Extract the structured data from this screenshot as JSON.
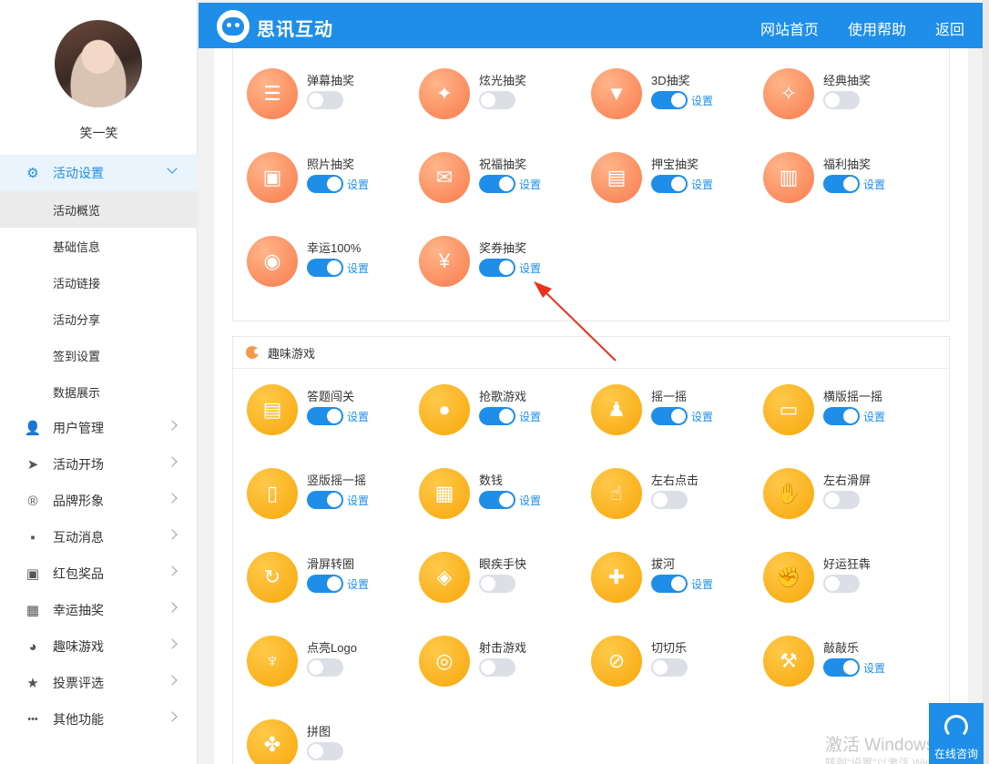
{
  "sidebar": {
    "username": "笑一笑",
    "menu": [
      {
        "label": "活动设置",
        "icon": "gears-icon",
        "active": true
      },
      {
        "label": "用户管理",
        "icon": "user-icon"
      },
      {
        "label": "活动开场",
        "icon": "paper-plane-icon"
      },
      {
        "label": "品牌形象",
        "icon": "registered-icon"
      },
      {
        "label": "互动消息",
        "icon": "message-icon"
      },
      {
        "label": "红包奖品",
        "icon": "red-packet-icon"
      },
      {
        "label": "幸运抽奖",
        "icon": "lottery-icon"
      },
      {
        "label": "趣味游戏",
        "icon": "game-icon"
      },
      {
        "label": "投票评选",
        "icon": "star-icon"
      },
      {
        "label": "其他功能",
        "icon": "more-icon"
      }
    ],
    "submenu": [
      "活动概览",
      "基础信息",
      "活动链接",
      "活动分享",
      "签到设置",
      "数据展示"
    ]
  },
  "header": {
    "brand": "思讯互动",
    "links": [
      "网站首页",
      "使用帮助",
      "返回"
    ]
  },
  "lottery": {
    "items": [
      {
        "name": "弹幕抽奖",
        "on": false,
        "icon": "list-icon",
        "glyph": "☰"
      },
      {
        "name": "炫光抽奖",
        "on": false,
        "icon": "sparkle-stars-icon",
        "glyph": "✦"
      },
      {
        "name": "3D抽奖",
        "on": true,
        "icon": "funnel-icon",
        "glyph": "▼"
      },
      {
        "name": "经典抽奖",
        "on": false,
        "icon": "twinkle-icon",
        "glyph": "✧"
      },
      {
        "name": "照片抽奖",
        "on": true,
        "icon": "photo-icon",
        "glyph": "▣"
      },
      {
        "name": "祝福抽奖",
        "on": true,
        "icon": "envelope-icon",
        "glyph": "✉"
      },
      {
        "name": "押宝抽奖",
        "on": true,
        "icon": "treasure-icon",
        "glyph": "▤"
      },
      {
        "name": "福利抽奖",
        "on": true,
        "icon": "gift-box-icon",
        "glyph": "▥"
      },
      {
        "name": "幸运100%",
        "on": true,
        "icon": "wheel-icon",
        "glyph": "◉"
      },
      {
        "name": "奖券抽奖",
        "on": true,
        "icon": "ticket-icon",
        "glyph": "¥"
      }
    ]
  },
  "games": {
    "title": "趣味游戏",
    "items": [
      {
        "name": "答题闯关",
        "on": true,
        "icon": "quiz-paper-icon",
        "glyph": "▤"
      },
      {
        "name": "抢歌游戏",
        "on": true,
        "icon": "microphone-icon",
        "glyph": "●"
      },
      {
        "name": "摇一摇",
        "on": true,
        "icon": "joystick-icon",
        "glyph": "♟"
      },
      {
        "name": "横版摇一摇",
        "on": true,
        "icon": "phone-landscape-icon",
        "glyph": "▭"
      },
      {
        "name": "竖版摇一摇",
        "on": true,
        "icon": "phone-portrait-icon",
        "glyph": "▯"
      },
      {
        "name": "数钱",
        "on": true,
        "icon": "money-icon",
        "glyph": "▦"
      },
      {
        "name": "左右点击",
        "on": false,
        "icon": "tap-hand-icon",
        "glyph": "☝"
      },
      {
        "name": "左右滑屏",
        "on": false,
        "icon": "swipe-hand-icon",
        "glyph": "✋"
      },
      {
        "name": "滑屏转圈",
        "on": true,
        "icon": "rotate-icon",
        "glyph": "↻"
      },
      {
        "name": "眼疾手快",
        "on": false,
        "icon": "eye-bolt-icon",
        "glyph": "◈"
      },
      {
        "name": "拔河",
        "on": true,
        "icon": "tug-of-war-icon",
        "glyph": "✚"
      },
      {
        "name": "好运狂犇",
        "on": false,
        "icon": "fist-icon",
        "glyph": "✊"
      },
      {
        "name": "点亮Logo",
        "on": false,
        "icon": "torch-icon",
        "glyph": "♆"
      },
      {
        "name": "射击游戏",
        "on": false,
        "icon": "target-icon",
        "glyph": "◎"
      },
      {
        "name": "切切乐",
        "on": false,
        "icon": "slice-icon",
        "glyph": "⊘"
      },
      {
        "name": "敲敲乐",
        "on": true,
        "icon": "hammer-icon",
        "glyph": "⚒"
      },
      {
        "name": "拼图",
        "on": false,
        "icon": "puzzle-icon",
        "glyph": "✤"
      }
    ]
  },
  "settings_label": "设置",
  "consult": {
    "label": "在线咨询"
  },
  "watermark": {
    "line1": "激活 Windows",
    "line2": "转到\"设置\"以激活 Windows。"
  },
  "colors": {
    "primary": "#1e8ee9",
    "lottery_icon": "#f87b4c",
    "game_icon": "#f7a70a",
    "toggle_off": "#dcdfe6"
  }
}
